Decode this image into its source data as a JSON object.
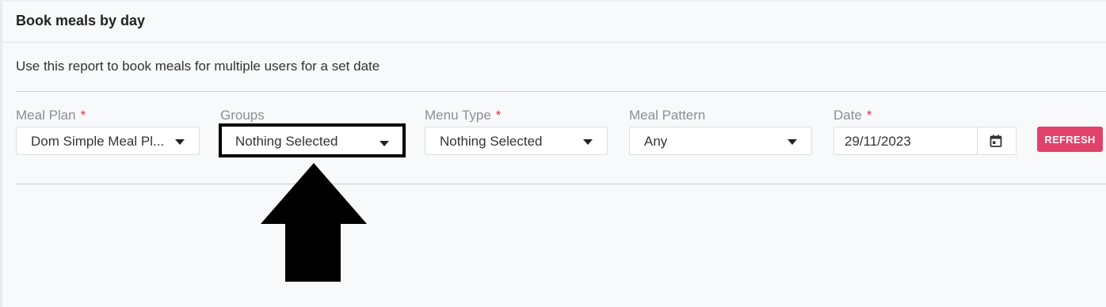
{
  "card": {
    "title": "Book meals by day",
    "description": "Use this report to book meals for multiple users for a set date"
  },
  "filters": {
    "meal_plan": {
      "label": "Meal Plan",
      "required_mark": "*",
      "value": "Dom Simple Meal Pl..."
    },
    "groups": {
      "label": "Groups",
      "value": "Nothing Selected"
    },
    "menu_type": {
      "label": "Menu Type",
      "required_mark": "*",
      "value": "Nothing Selected"
    },
    "meal_pattern": {
      "label": "Meal Pattern",
      "value": "Any"
    },
    "date": {
      "label": "Date",
      "required_mark": "*",
      "value": "29/11/2023",
      "icon": "calendar-icon"
    }
  },
  "actions": {
    "refresh_label": "REFRESH"
  },
  "colors": {
    "accent": "#e0426a",
    "required": "#dc3545",
    "annotation": "#000000"
  },
  "icons": {
    "dropdown": "caret-down-icon",
    "annotation": "arrow-up-icon"
  }
}
